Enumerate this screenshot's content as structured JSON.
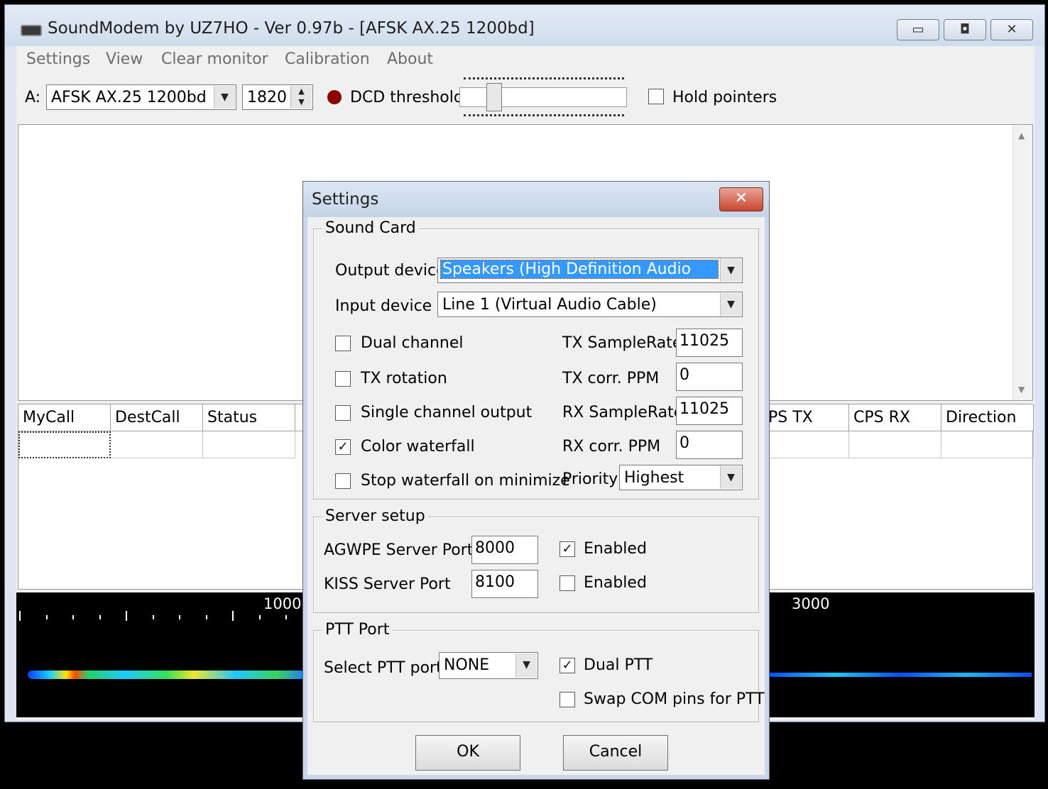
{
  "window": {
    "title": "SoundModem by UZ7HO - Ver 0.97b - [AFSK AX.25 1200bd]",
    "minimize_glyph": "▭",
    "maximize_glyph": "◘",
    "close_glyph": "✕"
  },
  "menu": {
    "items": [
      "Settings",
      "View",
      "Clear monitor",
      "Calibration",
      "About"
    ]
  },
  "toolbar": {
    "channel_label": "A:",
    "mode_value": "AFSK AX.25 1200bd",
    "freq_value": "1820",
    "dcd_label": "DCD threshold",
    "dcd_indicator_color": "#8b0000",
    "hold_pointers_label": "Hold pointers"
  },
  "grid": {
    "headers": [
      "MyCall",
      "DestCall",
      "Status",
      "",
      "PS TX",
      "CPS RX",
      "Direction"
    ]
  },
  "waterfall": {
    "freq_labels": [
      "1000",
      "3000"
    ]
  },
  "dialog": {
    "title": "Settings",
    "close_glyph": "✕",
    "sound_card": {
      "title": "Sound Card",
      "output_device_label": "Output device",
      "output_device_value": "Speakers (High Definition Audio",
      "input_device_label": "Input device",
      "input_device_value": "Line 1 (Virtual Audio Cable)",
      "dual_channel": {
        "label": "Dual channel",
        "checked": false
      },
      "tx_rotation": {
        "label": "TX rotation",
        "checked": false
      },
      "single_channel_output": {
        "label": "Single channel output",
        "checked": false
      },
      "color_waterfall": {
        "label": "Color waterfall",
        "checked": true
      },
      "stop_waterfall": {
        "label": "Stop waterfall on minimize",
        "checked": false
      },
      "tx_samplerate_label": "TX SampleRate",
      "tx_samplerate_value": "11025",
      "tx_corr_label": "TX corr. PPM",
      "tx_corr_value": "0",
      "rx_samplerate_label": "RX SampleRate",
      "rx_samplerate_value": "11025",
      "rx_corr_label": "RX corr. PPM",
      "rx_corr_value": "0",
      "priority_label": "Priority",
      "priority_value": "Highest"
    },
    "server": {
      "title": "Server setup",
      "agwpe_label": "AGWPE Server Port",
      "agwpe_value": "8000",
      "agwpe_enabled": {
        "label": "Enabled",
        "checked": true
      },
      "kiss_label": "KISS Server Port",
      "kiss_value": "8100",
      "kiss_enabled": {
        "label": "Enabled",
        "checked": false
      }
    },
    "ptt": {
      "title": "PTT Port",
      "select_label": "Select PTT port",
      "select_value": "NONE",
      "dual_ptt": {
        "label": "Dual PTT",
        "checked": true
      },
      "swap_com": {
        "label": "Swap COM pins for PTT",
        "checked": false
      }
    },
    "ok_label": "OK",
    "cancel_label": "Cancel",
    "check_glyph": "✓",
    "dropdown_glyph": "▼"
  }
}
